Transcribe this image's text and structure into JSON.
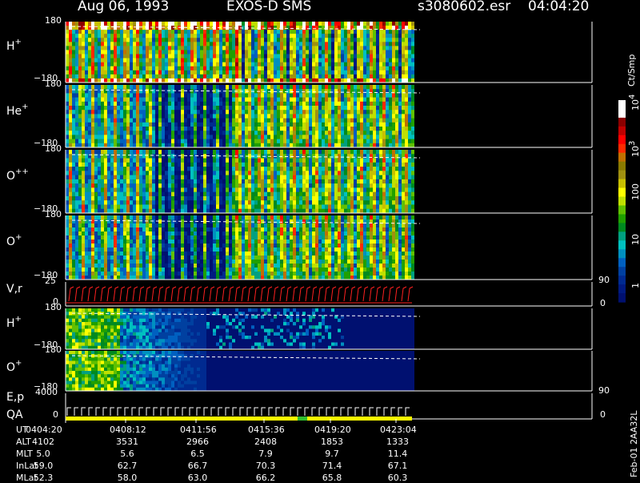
{
  "header": {
    "date": "Aug 06, 1993",
    "instrument": "EXOS-D SMS",
    "file": "s3080602.esr",
    "time": "04:04:20"
  },
  "panels": [
    {
      "label": "H",
      "sup": "+",
      "top": "180",
      "bottom": "−180"
    },
    {
      "label": "He",
      "sup": "+",
      "top": "180",
      "bottom": "−180"
    },
    {
      "label": "O",
      "sup": "++",
      "top": "180",
      "bottom": "−180"
    },
    {
      "label": "O",
      "sup": "+",
      "top": "180",
      "bottom": "−180"
    },
    {
      "label": "V,r",
      "sup": "",
      "top": "25",
      "bottom": "0"
    },
    {
      "label": "H",
      "sup": "+",
      "top": "180",
      "bottom": "−180"
    },
    {
      "label": "O",
      "sup": "+",
      "top": "180",
      "bottom": "−180"
    },
    {
      "label": "E,p",
      "sup": "",
      "top": "4000",
      "bottom": "0"
    }
  ],
  "qa_label": "QA",
  "right_axis": {
    "vr_top": "90",
    "vr_bottom": "0",
    "ep_top": "90",
    "ep_bottom": "0"
  },
  "colorbar": {
    "unit": "Ct/Smp",
    "ticks": [
      "10",
      "10",
      "100",
      "10",
      "1"
    ],
    "tick_exps": [
      "4",
      "3",
      "",
      "",
      ""
    ],
    "colors": [
      "#ffffff",
      "#ffffff",
      "#8b0000",
      "#c00000",
      "#ff0000",
      "#ff2a00",
      "#c07000",
      "#8a7a00",
      "#a09010",
      "#c8c000",
      "#ffff00",
      "#c0e000",
      "#60c000",
      "#20a000",
      "#008a20",
      "#00a080",
      "#00c0c0",
      "#0090c0",
      "#0060c0",
      "#0040a0",
      "#002a90",
      "#001a80",
      "#001070"
    ]
  },
  "footer": {
    "rows": [
      {
        "label": "UT",
        "values": [
          "0404:20",
          "0408:12",
          "0411:56",
          "0415:36",
          "0419:20",
          "0423:04"
        ]
      },
      {
        "label": "ALT",
        "values": [
          "4102",
          "3531",
          "2966",
          "2408",
          "1853",
          "1333"
        ]
      },
      {
        "label": "MLT",
        "values": [
          "5.0",
          "5.6",
          "6.5",
          "7.9",
          "9.7",
          "11.4"
        ]
      },
      {
        "label": "InLat",
        "values": [
          "59.0",
          "62.7",
          "66.7",
          "70.3",
          "71.4",
          "67.1"
        ]
      },
      {
        "label": "MLat",
        "values": [
          "52.3",
          "58.0",
          "63.0",
          "66.2",
          "65.8",
          "60.3"
        ]
      }
    ],
    "stamp": "Feb-01 2AA32L"
  },
  "chart_data": {
    "type": "heatmap",
    "title": "Aug 06, 1993   EXOS-D SMS",
    "x_ticks_ut": [
      "0404:20",
      "0408:12",
      "0411:56",
      "0415:36",
      "0419:20",
      "0423:04"
    ],
    "panels": [
      {
        "name": "H+",
        "ylim": [
          -180,
          180
        ]
      },
      {
        "name": "He+",
        "ylim": [
          -180,
          180
        ]
      },
      {
        "name": "O++",
        "ylim": [
          -180,
          180
        ]
      },
      {
        "name": "O+",
        "ylim": [
          -180,
          180
        ]
      },
      {
        "name": "V,r",
        "ylim": [
          0,
          25
        ],
        "right_ylim": [
          0,
          90
        ]
      },
      {
        "name": "H+",
        "ylim": [
          -180,
          180
        ]
      },
      {
        "name": "O+",
        "ylim": [
          -180,
          180
        ]
      },
      {
        "name": "E,p",
        "ylim": [
          0,
          4000
        ],
        "right_ylim": [
          0,
          90
        ]
      }
    ],
    "colorbar_unit": "Ct/Smp",
    "colorbar_range": [
      1,
      10000
    ],
    "colorbar_scale": "log"
  }
}
